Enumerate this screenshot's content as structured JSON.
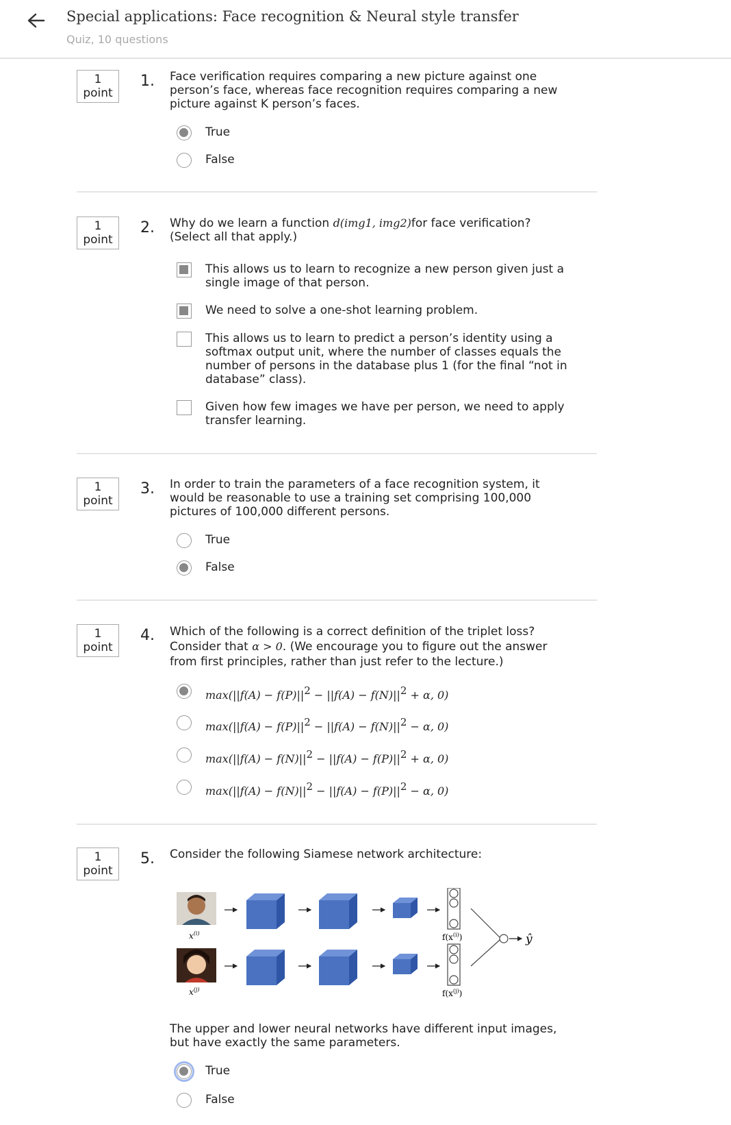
{
  "header": {
    "title": "Special applications: Face recognition & Neural style transfer",
    "subtitle": "Quiz, 10 questions"
  },
  "questions": [
    {
      "number": "1.",
      "points_value": "1",
      "points_unit": "point",
      "text": "Face verification requires comparing a new picture against one person’s face, whereas face recognition requires comparing a new picture against K person’s faces.",
      "type": "radio",
      "options": [
        {
          "label": "True",
          "selected": true
        },
        {
          "label": "False",
          "selected": false
        }
      ]
    },
    {
      "number": "2.",
      "points_value": "1",
      "points_unit": "point",
      "text_before": "Why do we learn a function ",
      "text_math": "d(img1, img2)",
      "text_after": "for face verification? (Select all that apply.)",
      "type": "checkbox",
      "options": [
        {
          "label": "This allows us to learn to recognize a new person given just a single image of that person.",
          "selected": true
        },
        {
          "label": "We need to solve a one-shot learning problem.",
          "selected": true
        },
        {
          "label": "This allows us to learn to predict a person’s identity using a softmax output unit, where the number of classes equals the number of persons in the database plus 1 (for the final “not in database” class).",
          "selected": false
        },
        {
          "label": "Given how few images we have per person, we need to apply transfer learning.",
          "selected": false
        }
      ]
    },
    {
      "number": "3.",
      "points_value": "1",
      "points_unit": "point",
      "text": "In order to train the parameters of a face recognition system, it would be reasonable to use a training set comprising 100,000 pictures of 100,000 different persons.",
      "type": "radio",
      "options": [
        {
          "label": "True",
          "selected": false
        },
        {
          "label": "False",
          "selected": true
        }
      ]
    },
    {
      "number": "4.",
      "points_value": "1",
      "points_unit": "point",
      "text_line1": "Which of the following is a correct definition of the triplet loss?",
      "text_before": "Consider that ",
      "text_math": "α > 0",
      "text_after": ". (We encourage you to figure out the answer from first principles, rather than just refer to the lecture.)",
      "type": "radio",
      "options": [
        {
          "a": "max(||f(A) − f(P)||",
          "b": " − ||f(A) − f(N)||",
          "c": " + α, 0)",
          "exp": "2",
          "selected": true
        },
        {
          "a": "max(||f(A) − f(P)||",
          "b": " − ||f(A) − f(N)||",
          "c": " − α, 0)",
          "exp": "2",
          "selected": false
        },
        {
          "a": "max(||f(A) − f(N)||",
          "b": " − ||f(A) − f(P)||",
          "c": " + α, 0)",
          "exp": "2",
          "selected": false
        },
        {
          "a": "max(||f(A) − f(N)||",
          "b": " − ||f(A) − f(P)||",
          "c": " − α, 0)",
          "exp": "2",
          "selected": false
        }
      ]
    },
    {
      "number": "5.",
      "points_value": "1",
      "points_unit": "point",
      "text": "Consider the following Siamese network architecture:",
      "diagram": {
        "input_top": "x",
        "input_top_sup": "(i)",
        "input_bottom": "x",
        "input_bottom_sup": "(j)",
        "encoding_top": "f(x",
        "encoding_top_sup": "(i)",
        "encoding_bottom": "f(x",
        "encoding_bottom_sup": "(j)",
        "close_paren": ")",
        "output": "ŷ",
        "block_color": "#4a72c0"
      },
      "followup": "The upper and lower neural networks have different input images, but have exactly the same parameters.",
      "type": "radio",
      "options": [
        {
          "label": "True",
          "selected": true
        },
        {
          "label": "False",
          "selected": false
        }
      ]
    }
  ]
}
